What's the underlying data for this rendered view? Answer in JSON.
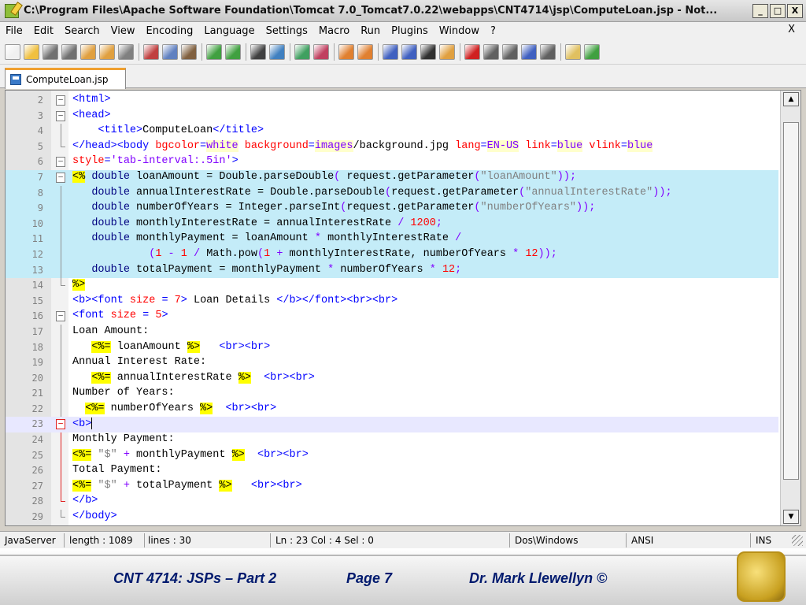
{
  "window": {
    "title": "C:\\Program Files\\Apache Software Foundation\\Tomcat 7.0_Tomcat7.0.22\\webapps\\CNT4714\\jsp\\ComputeLoan.jsp - Not...",
    "buttons": {
      "minimize": "_",
      "maximize": "□",
      "close": "X"
    }
  },
  "menu": {
    "items": [
      "File",
      "Edit",
      "Search",
      "View",
      "Encoding",
      "Language",
      "Settings",
      "Macro",
      "Run",
      "Plugins",
      "Window",
      "?"
    ],
    "close": "X"
  },
  "toolbar": {
    "icons": [
      {
        "name": "new-file-icon",
        "color": "#f0f0f0"
      },
      {
        "name": "open-file-icon",
        "color": "#f0c040"
      },
      {
        "name": "save-icon",
        "color": "#707070"
      },
      {
        "name": "save-all-icon",
        "color": "#707070"
      },
      {
        "name": "close-icon",
        "color": "#e0a040"
      },
      {
        "name": "close-all-icon",
        "color": "#e0a040"
      },
      {
        "name": "print-icon",
        "color": "#808080"
      },
      {
        "sep": true
      },
      {
        "name": "cut-icon",
        "color": "#c04040"
      },
      {
        "name": "copy-icon",
        "color": "#6080c0"
      },
      {
        "name": "paste-icon",
        "color": "#806040"
      },
      {
        "sep": true
      },
      {
        "name": "undo-icon",
        "color": "#40a040"
      },
      {
        "name": "redo-icon",
        "color": "#40a040"
      },
      {
        "sep": true
      },
      {
        "name": "find-icon",
        "color": "#404040"
      },
      {
        "name": "replace-icon",
        "color": "#4080c0"
      },
      {
        "sep": true
      },
      {
        "name": "zoom-in-icon",
        "color": "#40a060"
      },
      {
        "name": "zoom-out-icon",
        "color": "#c04060"
      },
      {
        "sep": true
      },
      {
        "name": "sync-vertical-icon",
        "color": "#e08030"
      },
      {
        "name": "sync-horizontal-icon",
        "color": "#e08030"
      },
      {
        "sep": true
      },
      {
        "name": "word-wrap-icon",
        "color": "#4060c0"
      },
      {
        "name": "show-all-chars-icon",
        "color": "#4060c0"
      },
      {
        "name": "indent-guide-icon",
        "color": "#303030"
      },
      {
        "name": "language-icon",
        "color": "#e0a040"
      },
      {
        "sep": true
      },
      {
        "name": "record-macro-icon",
        "color": "#d02020"
      },
      {
        "name": "stop-record-icon",
        "color": "#606060"
      },
      {
        "name": "play-macro-icon",
        "color": "#606060"
      },
      {
        "name": "run-macro-multiple-icon",
        "color": "#4060c0"
      },
      {
        "name": "save-macro-icon",
        "color": "#606060"
      },
      {
        "sep": true
      },
      {
        "name": "file-browser-icon",
        "color": "#e0c060"
      },
      {
        "name": "spell-check-icon",
        "color": "#40a040"
      }
    ]
  },
  "tab": {
    "label": "ComputeLoan.jsp"
  },
  "editor": {
    "lines": [
      {
        "n": "2",
        "fold": "box",
        "html": "<span class=\"tag\">&lt;html&gt;</span>"
      },
      {
        "n": "3",
        "fold": "box",
        "html": "<span class=\"tag\">&lt;head&gt;</span>"
      },
      {
        "n": "4",
        "fold": "vline",
        "html": "    <span class=\"tag\">&lt;title&gt;</span>ComputeLoan<span class=\"tag\">&lt;/title&gt;</span>"
      },
      {
        "n": "5",
        "fold": "end",
        "html": "<span class=\"tag\">&lt;/head&gt;&lt;body </span><span class=\"attr\">bgcolor</span><span class=\"tag\">=</span><span class=\"aval-b\">white</span> <span class=\"attr\">background</span><span class=\"tag\">=</span><span class=\"aval-b\">images</span>/background.jpg <span class=\"attr\">lang</span><span class=\"tag\">=</span><span class=\"aval-b\">EN-US</span> <span class=\"attr\">link</span><span class=\"tag\">=</span><span class=\"aval-b\">blue</span> <span class=\"attr\">vlink</span><span class=\"tag\">=</span><span class=\"aval-b\">blue</span>"
      },
      {
        "n": "6",
        "fold": "box",
        "html": "<span class=\"attr\">style</span><span class=\"tag\">=</span><span class=\"aval\">'tab-interval:.5in'</span><span class=\"tag\">&gt;</span>"
      },
      {
        "n": "7",
        "fold": "box",
        "hl": true,
        "html": "<span class=\"jsp\">&lt;%</span> <span class=\"kw\">double</span> loanAmount = Double.parseDouble<span class=\"op\">(</span> request.getParameter<span class=\"op\">(</span><span class=\"str\">\"loanAmount\"</span><span class=\"op\">));</span>"
      },
      {
        "n": "8",
        "fold": "vline",
        "hl": true,
        "html": "   <span class=\"kw\">double</span> annualInterestRate = Double.parseDouble<span class=\"op\">(</span>request.getParameter<span class=\"op\">(</span><span class=\"str\">\"annualInterestRate\"</span><span class=\"op\">));</span>"
      },
      {
        "n": "9",
        "fold": "vline",
        "hl": true,
        "html": "   <span class=\"kw\">double</span> numberOfYears = Integer.parseInt<span class=\"op\">(</span>request.getParameter<span class=\"op\">(</span><span class=\"str\">\"numberOfYears\"</span><span class=\"op\">));</span>"
      },
      {
        "n": "10",
        "fold": "vline",
        "hl": true,
        "html": "   <span class=\"kw\">double</span> monthlyInterestRate = annualInterestRate <span class=\"op\">/</span> <span class=\"num\">1200</span><span class=\"op\">;</span>"
      },
      {
        "n": "11",
        "fold": "vline",
        "hl": true,
        "html": "   <span class=\"kw\">double</span> monthlyPayment = loanAmount <span class=\"op\">*</span> monthlyInterestRate <span class=\"op\">/</span>"
      },
      {
        "n": "12",
        "fold": "vline",
        "hl": true,
        "html": "            <span class=\"op\">(</span><span class=\"num\">1</span> <span class=\"op\">-</span> <span class=\"num\">1</span> <span class=\"op\">/</span> Math.pow<span class=\"op\">(</span><span class=\"num\">1</span> <span class=\"op\">+</span> monthlyInterestRate, numberOfYears <span class=\"op\">*</span> <span class=\"num\">12</span><span class=\"op\">));</span>"
      },
      {
        "n": "13",
        "fold": "vline",
        "hl": true,
        "html": "   <span class=\"kw\">double</span> totalPayment = monthlyPayment <span class=\"op\">*</span> numberOfYears <span class=\"op\">*</span> <span class=\"num\">12</span><span class=\"op\">;</span>"
      },
      {
        "n": "14",
        "fold": "end",
        "html": "<span class=\"jsp\">%&gt;</span>"
      },
      {
        "n": "15",
        "fold": "",
        "html": "<span class=\"tag\">&lt;b&gt;&lt;font </span><span class=\"attr\">size</span> <span class=\"tag\">=</span> <span class=\"num\">7</span><span class=\"tag\">&gt;</span> Loan Details <span class=\"tag\">&lt;/b&gt;&lt;/font&gt;&lt;br&gt;&lt;br&gt;</span>"
      },
      {
        "n": "16",
        "fold": "box",
        "html": "<span class=\"tag\">&lt;font </span><span class=\"attr\">size</span> <span class=\"tag\">=</span> <span class=\"num\">5</span><span class=\"tag\">&gt;</span>"
      },
      {
        "n": "17",
        "fold": "vline",
        "html": "Loan Amount:"
      },
      {
        "n": "18",
        "fold": "vline",
        "html": "   <span class=\"jsp\">&lt;%=</span> loanAmount <span class=\"jsp\">%&gt;</span>   <span class=\"tag\">&lt;br&gt;&lt;br&gt;</span>"
      },
      {
        "n": "19",
        "fold": "vline",
        "html": "Annual Interest Rate:"
      },
      {
        "n": "20",
        "fold": "vline",
        "html": "   <span class=\"jsp\">&lt;%=</span> annualInterestRate <span class=\"jsp\">%&gt;</span>  <span class=\"tag\">&lt;br&gt;&lt;br&gt;</span>"
      },
      {
        "n": "21",
        "fold": "vline",
        "html": "Number of Years:"
      },
      {
        "n": "22",
        "fold": "vline",
        "html": "  <span class=\"jsp\">&lt;%=</span> numberOfYears <span class=\"jsp\">%&gt;</span>  <span class=\"tag\">&lt;br&gt;&lt;br&gt;</span>"
      },
      {
        "n": "23",
        "fold": "box-red",
        "cur": true,
        "html": "<span class=\"tag\">&lt;b&gt;</span><span class=\"caret\"></span>"
      },
      {
        "n": "24",
        "fold": "vline-red",
        "html": "Monthly Payment:"
      },
      {
        "n": "25",
        "fold": "vline-red",
        "html": "<span class=\"jsp\">&lt;%=</span> <span class=\"str\">\"$\"</span> <span class=\"op\">+</span> monthlyPayment <span class=\"jsp\">%&gt;</span>  <span class=\"tag\">&lt;br&gt;&lt;br&gt;</span>"
      },
      {
        "n": "26",
        "fold": "vline-red",
        "html": "Total Payment:"
      },
      {
        "n": "27",
        "fold": "vline-red",
        "html": "<span class=\"jsp\">&lt;%=</span> <span class=\"str\">\"$\"</span> <span class=\"op\">+</span> totalPayment <span class=\"jsp\">%&gt;</span>   <span class=\"tag\">&lt;br&gt;&lt;br&gt;</span>"
      },
      {
        "n": "28",
        "fold": "end-red",
        "html": "<span class=\"tag\">&lt;/b&gt;</span>"
      },
      {
        "n": "29",
        "fold": "end",
        "html": "<span class=\"tag\">&lt;/body&gt;</span>"
      }
    ]
  },
  "status": {
    "language": "JavaServer",
    "length": "length : 1089",
    "lines": "lines : 30",
    "position": "Ln : 23    Col : 4    Sel : 0",
    "eol": "Dos\\Windows",
    "encoding": "ANSI",
    "mode": "INS"
  },
  "footer": {
    "course": "CNT 4714: JSPs – Part 2",
    "page": "Page 7",
    "author": "Dr. Mark Llewellyn ©"
  }
}
